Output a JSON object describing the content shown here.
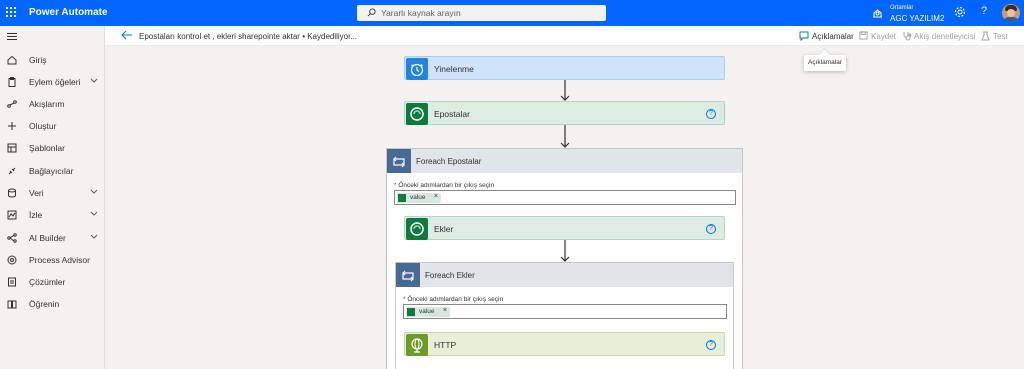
{
  "app": {
    "title": "Power Automate"
  },
  "search": {
    "placeholder": "Yararlı kaynak arayın"
  },
  "environment": {
    "label": "Ortamlar",
    "value": "AGC YAZILIM2"
  },
  "nav": {
    "items": [
      {
        "label": "Giriş",
        "icon": "home-icon"
      },
      {
        "label": "Eylem öğeleri",
        "icon": "clipboard-icon",
        "expandable": true
      },
      {
        "label": "Akışlarım",
        "icon": "flow-icon"
      },
      {
        "label": "Oluştur",
        "icon": "plus-icon"
      },
      {
        "label": "Şablonlar",
        "icon": "template-icon"
      },
      {
        "label": "Bağlayıcılar",
        "icon": "connector-icon"
      },
      {
        "label": "Veri",
        "icon": "database-icon",
        "expandable": true
      },
      {
        "label": "İzle",
        "icon": "monitor-icon",
        "expandable": true
      },
      {
        "label": "AI Builder",
        "icon": "ai-builder-icon",
        "expandable": true
      },
      {
        "label": "Process Advisor",
        "icon": "process-advisor-icon"
      },
      {
        "label": "Çözümler",
        "icon": "solutions-icon"
      },
      {
        "label": "Öğrenin",
        "icon": "book-icon"
      }
    ]
  },
  "commandbar": {
    "flow_title": "Epostaları kontrol et , ekleri sharepointe aktar • Kaydediliyor...",
    "comments": "Açıklamalar",
    "save": "Kaydet",
    "checker": "Akış denetleyicisi",
    "test": "Test",
    "tooltip": "Açıklamalar"
  },
  "flow": {
    "trigger": {
      "title": "Yinelenme",
      "icon": "clock-icon",
      "color": "#0078d4"
    },
    "step1": {
      "title": "Epostalar",
      "icon": "dataverse-icon",
      "color": "#0e7a3d"
    },
    "foreach1": {
      "title": "Foreach Epostalar",
      "field_label": "Önceki adımlardan bir çıkış seçin",
      "token": "value",
      "inner": {
        "title": "Ekler"
      }
    },
    "foreach2": {
      "title": "Foreach Ekler",
      "field_label": "Önceki adımlardan bir çıkış seçin",
      "token": "value",
      "inner": {
        "title": "HTTP",
        "icon": "globe-icon",
        "color": "#6e9a2a"
      }
    }
  },
  "colors": {
    "brand": "#0066ff",
    "loop": "#486991",
    "dataverse": "#0e7a3d",
    "http": "#6e9a2a"
  }
}
